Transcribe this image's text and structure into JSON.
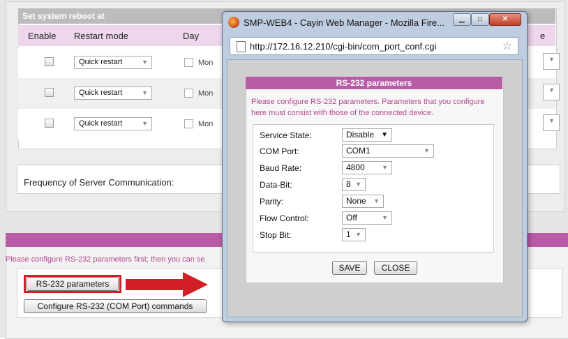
{
  "reboot": {
    "header": "Set system reboot at",
    "columns": [
      "Enable",
      "Restart mode",
      "Day"
    ],
    "column_tail": "e",
    "rows": [
      {
        "mode": "Quick restart",
        "day": "Mon"
      },
      {
        "mode": "Quick restart",
        "day": "Mon"
      },
      {
        "mode": "Quick restart",
        "day": "Mon"
      }
    ]
  },
  "frequency": {
    "label": "Frequency of Server Communication:"
  },
  "rs232": {
    "note": "Please configure RS-232 parameters first; then you can se",
    "params_button": "RS-232 parameters",
    "commands_button": "Configure RS-232 (COM Port) commands"
  },
  "popup": {
    "title": "SMP-WEB4 - Cayin Web Manager - Mozilla Fire...",
    "url": "http://172.16.12.210/cgi-bin/com_port_conf.cgi",
    "dialog_title": "RS-232 parameters",
    "dialog_note": "Please configure RS-232 parameters. Parameters that you configure here must consist with those of the connected device.",
    "fields": [
      {
        "label": "Service State:",
        "value": "Disable"
      },
      {
        "label": "COM Port:",
        "value": "COM1"
      },
      {
        "label": "Baud Rate:",
        "value": "4800"
      },
      {
        "label": "Data-Bit:",
        "value": "8"
      },
      {
        "label": "Parity:",
        "value": "None"
      },
      {
        "label": "Flow Control:",
        "value": "Off"
      },
      {
        "label": "Stop Bit:",
        "value": "1"
      }
    ],
    "save_label": "SAVE",
    "close_label": "CLOSE"
  },
  "colors": {
    "accent": "#b85ca8",
    "table_head": "#eed6ec",
    "highlight": "#d21f26"
  },
  "icons": [
    "firefox-icon",
    "page-icon",
    "bookmark-star-icon",
    "minimize-icon",
    "maximize-icon",
    "close-icon",
    "red-arrow-icon"
  ]
}
